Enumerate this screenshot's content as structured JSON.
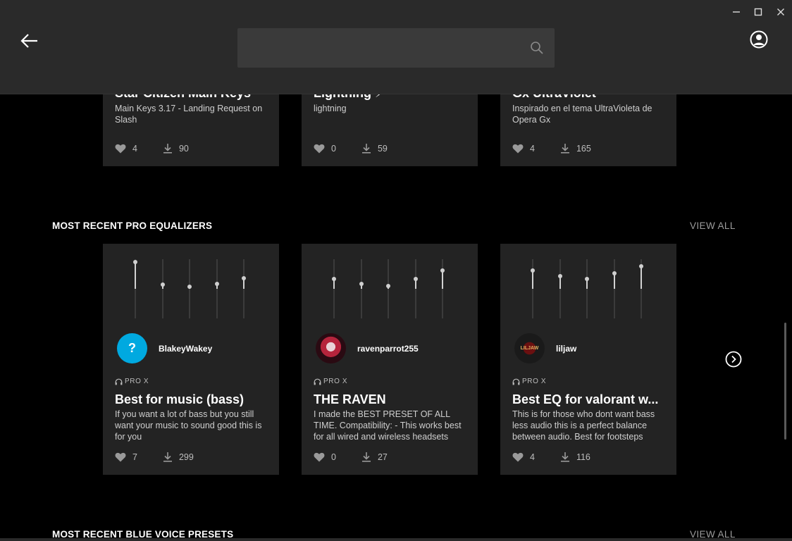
{
  "header": {
    "search_placeholder": ""
  },
  "top_row": [
    {
      "title": "Star Citizen Main Keys",
      "description": "Main Keys 3.17 - Landing Request on Slash",
      "likes": "4",
      "downloads": "90"
    },
    {
      "title": "Lightning ⚡",
      "description": "lightning",
      "likes": "0",
      "downloads": "59"
    },
    {
      "title": "Gx UltraViolet",
      "description": "Inspirado en el tema UltraVioleta de Opera Gx",
      "likes": "4",
      "downloads": "165"
    }
  ],
  "equalizers_section": {
    "title": "MOST RECENT PRO EQUALIZERS",
    "view_all": "VIEW ALL",
    "cards": [
      {
        "username": "BlakeyWakey",
        "avatar_text": "?",
        "device": "PRO X",
        "title": "Best for music (bass)",
        "description": "If you want a lot of bass but you still want your music to sound good this is for you",
        "likes": "7",
        "downloads": "299",
        "eq_levels": [
          0.95,
          0.57,
          0.54,
          0.58,
          0.68
        ]
      },
      {
        "username": "ravenparrot255",
        "avatar_text": "",
        "device": "PRO X",
        "title": "THE RAVEN",
        "description": "I made the BEST PRESET OF ALL TIME. Compatibility: - This works best for all wired and wireless headsets",
        "likes": "0",
        "downloads": "27",
        "eq_levels": [
          0.67,
          0.58,
          0.55,
          0.67,
          0.81
        ]
      },
      {
        "username": "liljaw",
        "avatar_text": "LILJAW",
        "device": "PRO X",
        "title": "Best EQ for valorant w...",
        "description": "This is for those who dont want bass less audio this is a perfect balance between audio. Best for footsteps",
        "likes": "4",
        "downloads": "116",
        "eq_levels": [
          0.81,
          0.72,
          0.67,
          0.76,
          0.88
        ]
      }
    ]
  },
  "blue_voice_section": {
    "title": "MOST RECENT BLUE VOICE PRESETS",
    "view_all": "VIEW ALL"
  },
  "icons": {
    "back": "arrow-left-icon",
    "search": "search-icon",
    "profile": "user-circle-icon",
    "like": "heart-icon",
    "download": "download-icon",
    "headset": "headset-icon",
    "next": "chevron-right-circle-icon"
  },
  "colors": {
    "background": "#000000",
    "card": "#232323",
    "header": "#2a2a2a",
    "avatar_blue": "#00a9e0",
    "muted_text": "#9c9c9c"
  }
}
